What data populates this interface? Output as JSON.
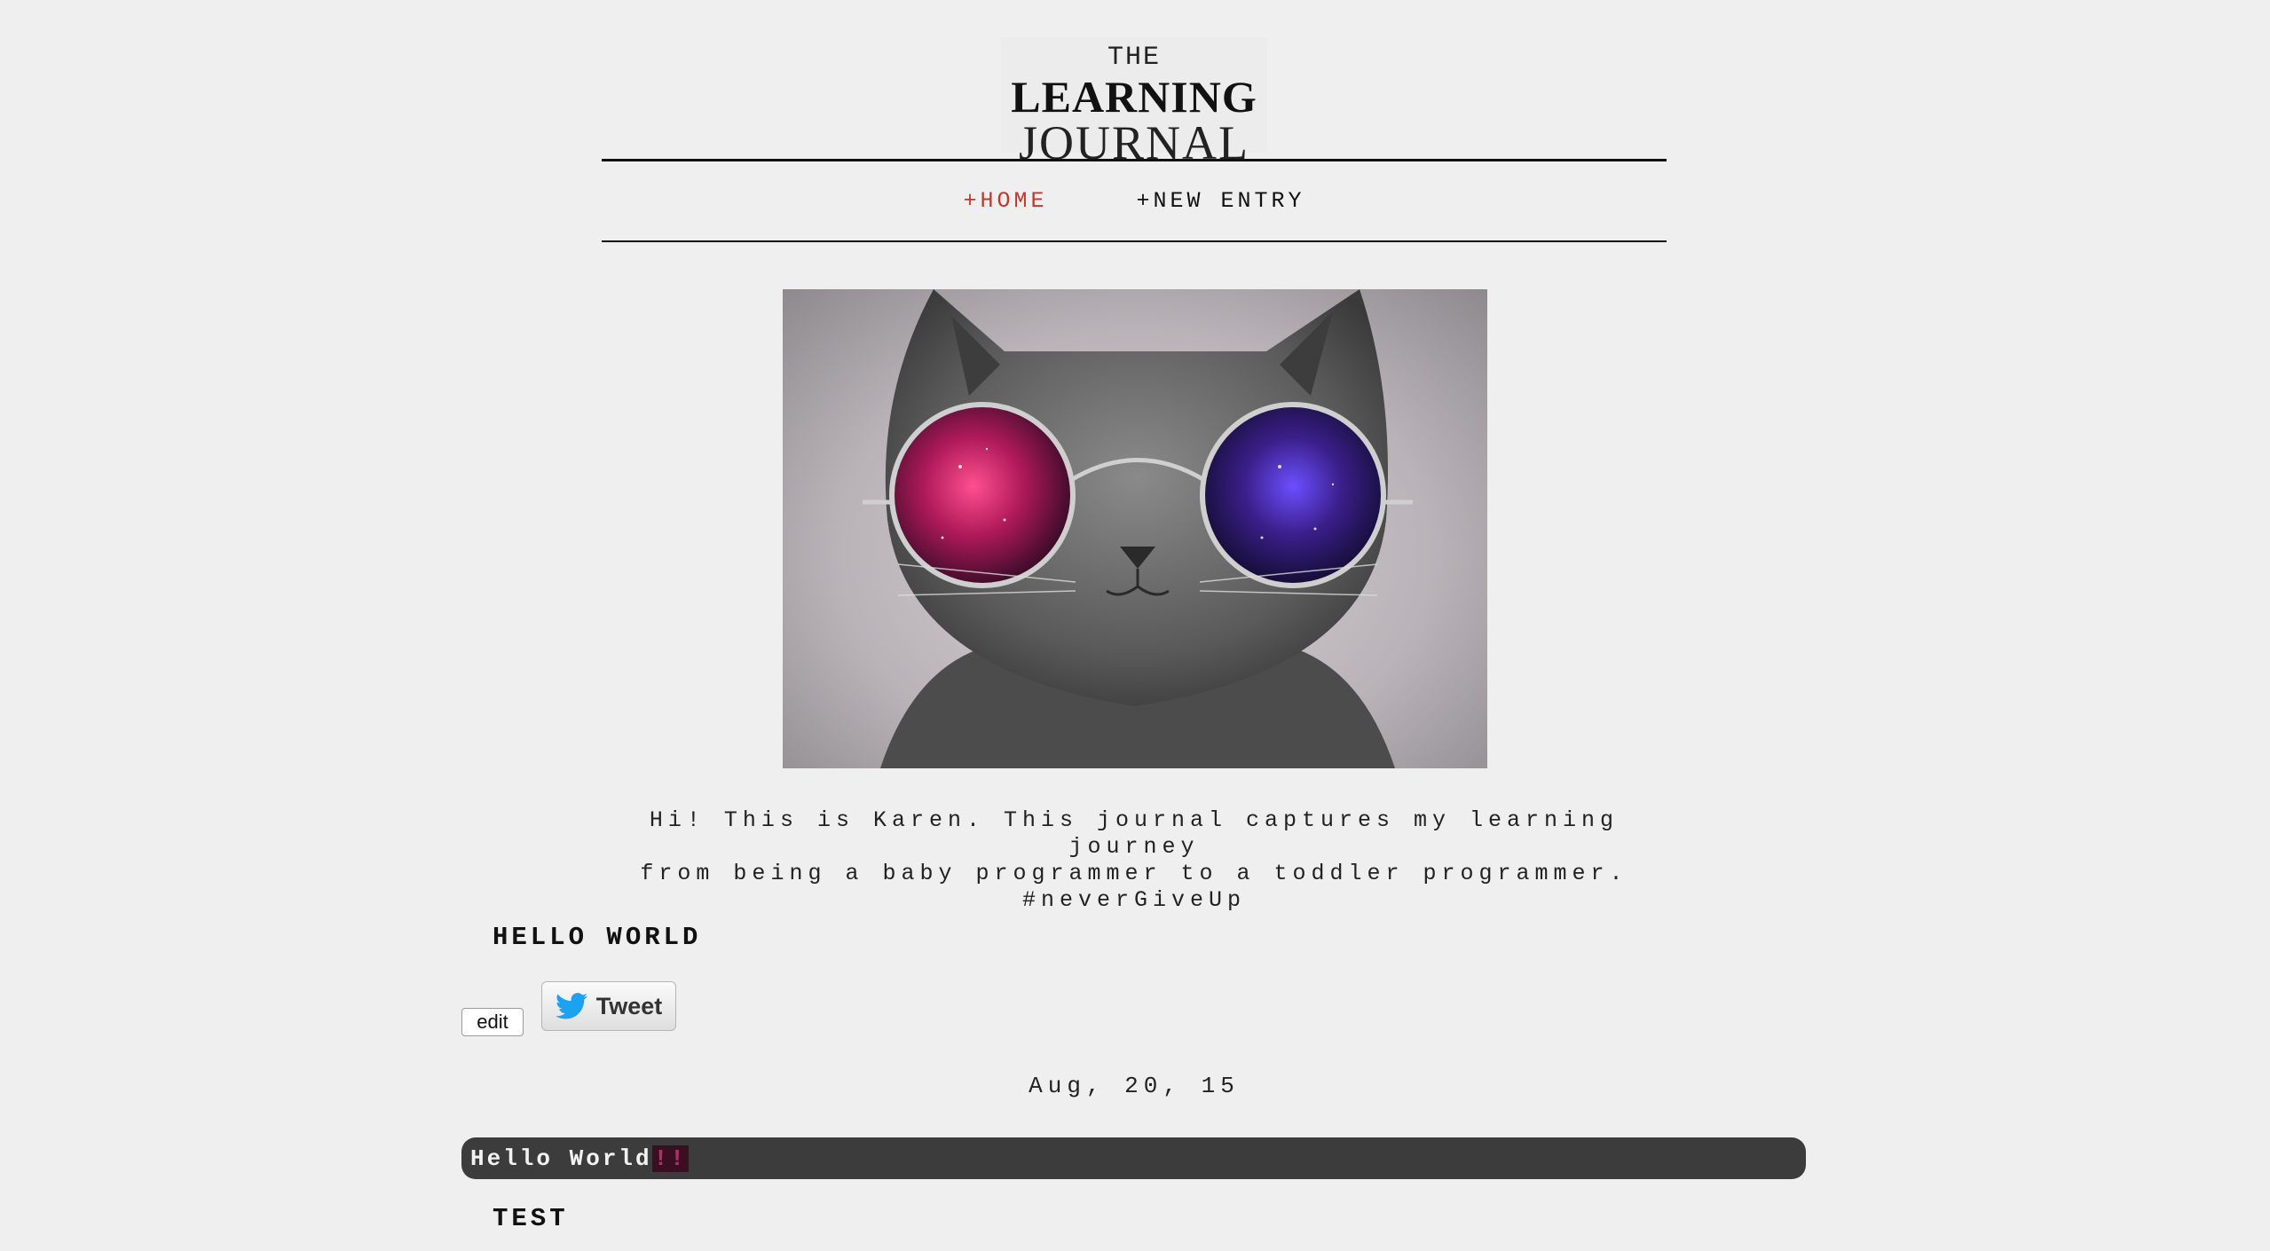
{
  "logo": {
    "line1": "THE",
    "line2": "LEARNING",
    "line3": "JOURNAL"
  },
  "nav": {
    "items": [
      {
        "label": "+HOME",
        "active": true
      },
      {
        "label": "+NEW ENTRY",
        "active": false
      }
    ],
    "active_color": "#c0392b"
  },
  "hero": {
    "icon": "cat-with-galaxy-sunglasses-photo"
  },
  "intro": {
    "line1": "Hi! This is Karen. This journal captures my learning journey",
    "line2": "from being a baby programmer to a toddler programmer.",
    "line3": "#neverGiveUp"
  },
  "entries": [
    {
      "title": "HELLO WORLD",
      "edit_label": "edit",
      "tweet_label": "Tweet",
      "date": "Aug, 20, 15",
      "content_text": "Hello World",
      "content_highlight": "!!"
    },
    {
      "title": "TEST"
    }
  ],
  "colors": {
    "background": "#efefef",
    "content_bar": "#3c3c3c",
    "twitter_blue": "#1da1f2"
  }
}
